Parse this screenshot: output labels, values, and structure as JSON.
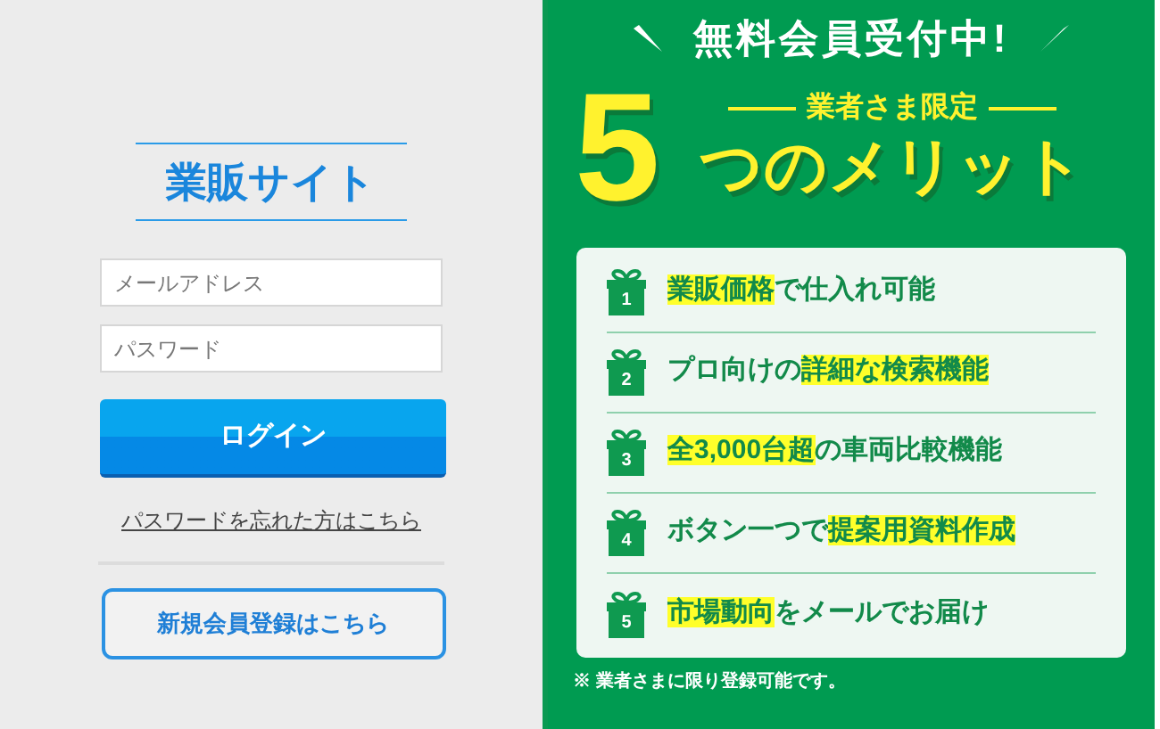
{
  "login": {
    "title": "業販サイト",
    "email_placeholder": "メールアドレス",
    "password_placeholder": "パスワード",
    "login_button": "ログイン",
    "forgot_link": "パスワードを忘れた方はこちら",
    "register_button": "新規会員登録はこちら"
  },
  "banner": {
    "headline": "無料会員受付中!",
    "big_number": "5",
    "subtitle": "業者さま限定",
    "title": "つのメリット",
    "merits": [
      {
        "number": "1",
        "parts": [
          {
            "text": "業販価格",
            "highlight": true
          },
          {
            "text": "で仕入れ可能",
            "highlight": false
          }
        ]
      },
      {
        "number": "2",
        "parts": [
          {
            "text": "プロ向けの",
            "highlight": false
          },
          {
            "text": "詳細な検索機能",
            "highlight": true
          }
        ]
      },
      {
        "number": "3",
        "parts": [
          {
            "text": "全3,000台超",
            "highlight": true
          },
          {
            "text": "の車両比較機能",
            "highlight": false
          }
        ]
      },
      {
        "number": "4",
        "parts": [
          {
            "text": "ボタン一つで",
            "highlight": false
          },
          {
            "text": "提案用資料作成",
            "highlight": true
          }
        ]
      },
      {
        "number": "5",
        "parts": [
          {
            "text": "市場動向",
            "highlight": true
          },
          {
            "text": "をメールでお届け",
            "highlight": false
          }
        ]
      }
    ],
    "note": "※ 業者さまに限り登録可能です。"
  }
}
